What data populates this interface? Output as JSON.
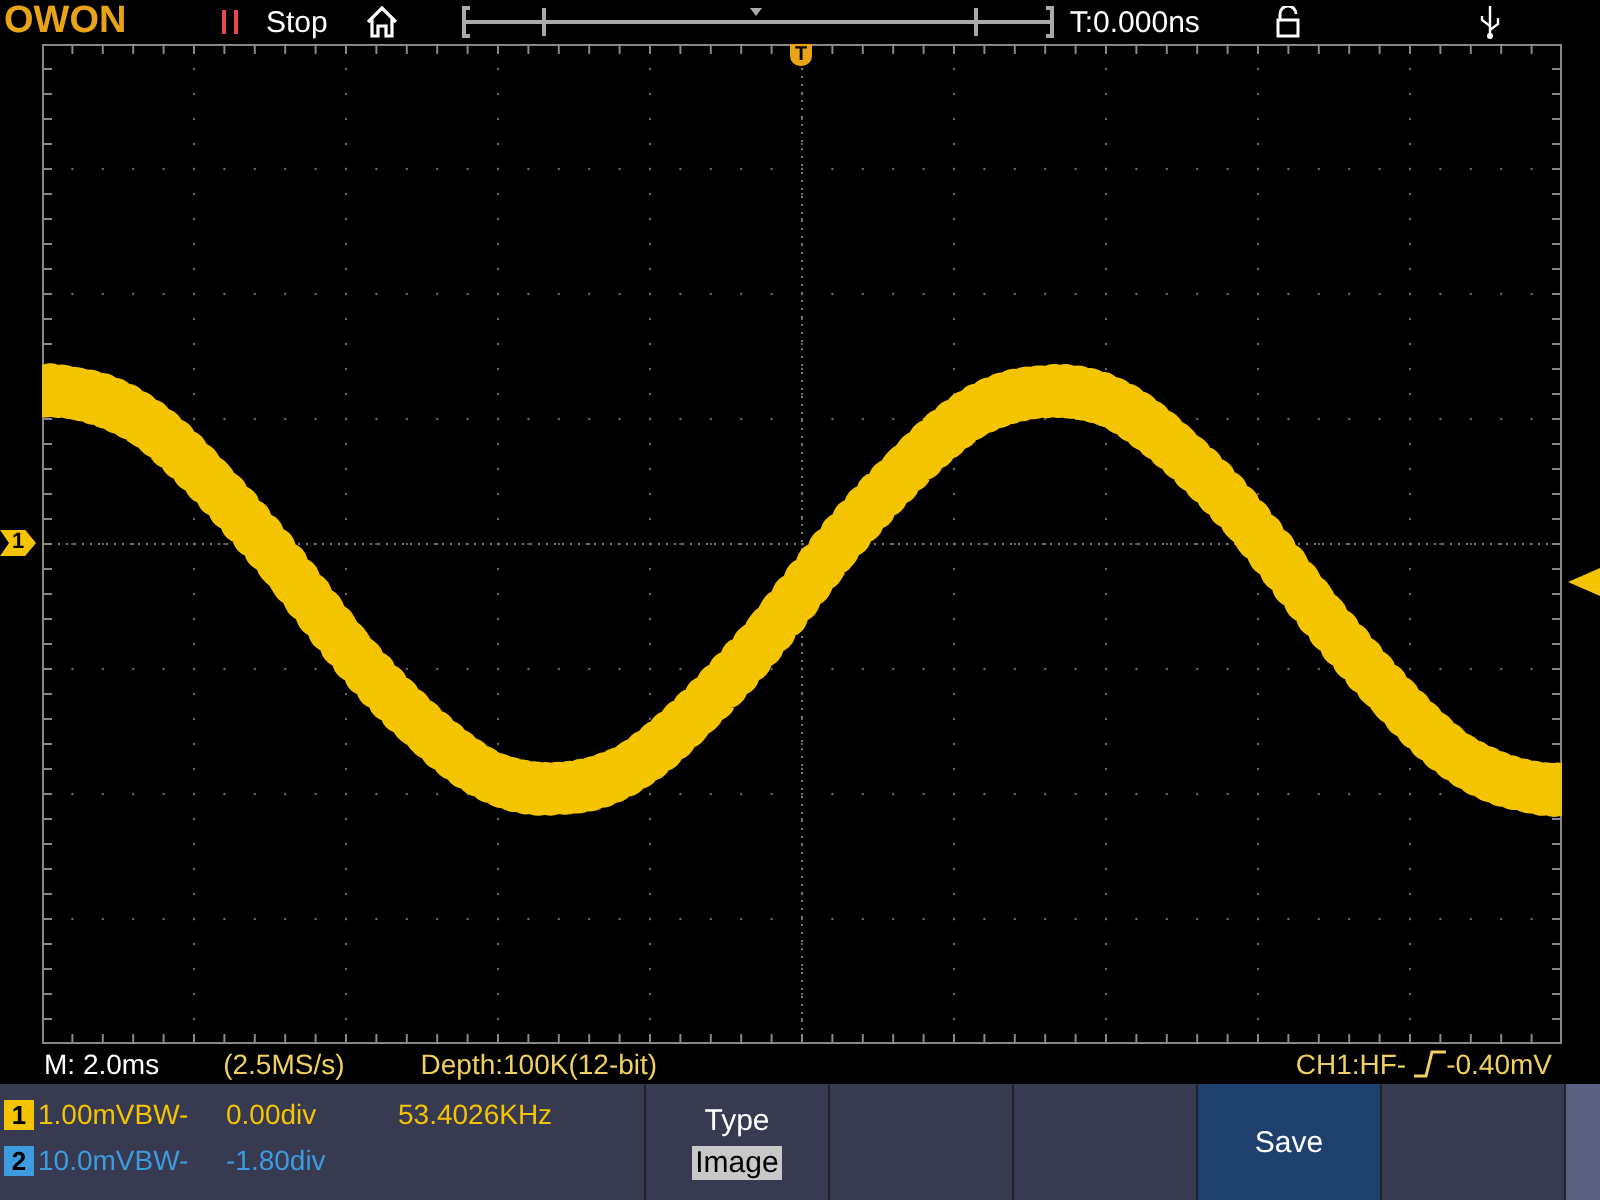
{
  "top_bar": {
    "logo": "OWON",
    "run_state": "Stop",
    "trigger_time": "T:0.000ns"
  },
  "markers": {
    "trigger_position": "T",
    "channel_1": "1"
  },
  "status_line": {
    "timebase": "M: 2.0ms",
    "sample_rate": "(2.5MS/s)",
    "depth": "Depth:100K(12-bit)",
    "trigger": "CH1:HF-",
    "trigger_level": "-0.40mV"
  },
  "channels": [
    {
      "number": "1",
      "color": "#f5c400",
      "scale": "1.00mVBW-",
      "offset": "0.00div",
      "frequency": "53.4026KHz"
    },
    {
      "number": "2",
      "color": "#3d9be0",
      "scale": "10.0mVBW-",
      "offset": "-1.80div"
    }
  ],
  "softkeys": [
    {
      "label": "Type",
      "value": "Image",
      "selected": false
    },
    {
      "selected": false
    },
    {
      "selected": false
    },
    {
      "label": "Save",
      "selected": true
    },
    {
      "selected": false
    }
  ]
}
